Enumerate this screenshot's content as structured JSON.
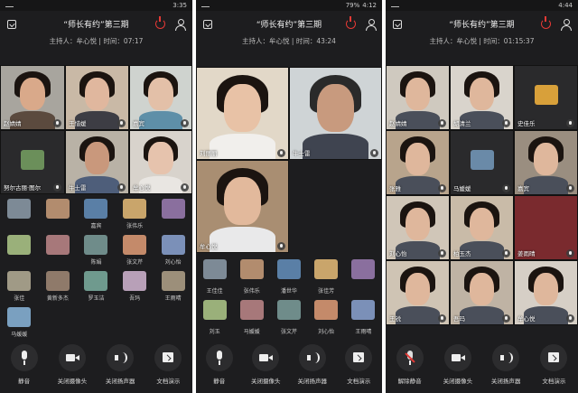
{
  "panels": [
    {
      "status": {
        "time": "3:35",
        "battery": ""
      },
      "title": "“师长有约”第三期",
      "host_label": "主持人：牟心悦",
      "time_label": "时间：07:17",
      "tiles": [
        "赵婧婧",
        "王惜媛",
        "嘉宾",
        "努尔古丽·图尔",
        "牛士雷",
        "牟心悦"
      ],
      "thumbs": [
        "",
        "",
        "嘉宾",
        "张伟乐",
        "",
        "",
        "",
        "陈娟",
        "张文芹",
        "刘心怡",
        "张佳",
        "黄新多杰",
        "罗玉洁",
        "吾玛",
        "王雨晴",
        "马媛媛"
      ],
      "toolbar": [
        "静音",
        "关闭摄像头",
        "关闭扬声器",
        "文档演示"
      ]
    },
    {
      "status": {
        "time": "4:12",
        "battery": "79%"
      },
      "title": "“师长有约”第三期",
      "host_label": "主持人：牟心悦",
      "time_label": "时间：43:24",
      "tiles": [
        "刘丽丽",
        "牛士雷",
        "牟心悦"
      ],
      "thumbs": [
        "王佳佳",
        "张伟乐",
        "潘世华",
        "张佳芳",
        "",
        "刘玉",
        "马媛媛",
        "张文芹",
        "刘心怡",
        "王雨晴"
      ],
      "toolbar": [
        "静音",
        "关闭摄像头",
        "关闭扬声器",
        "文档演示"
      ]
    },
    {
      "status": {
        "time": "4:44",
        "battery": ""
      },
      "title": "“师长有约”第三期",
      "host_label": "主持人：牟心悦",
      "time_label": "时间：01:15:37",
      "tiles": [
        "赵婧婧",
        "胡清兰",
        "史佳乐",
        "张雅",
        "马媛媛",
        "嘉宾",
        "刘心怡",
        "柏玉杰",
        "姜雨晴",
        "王锐",
        "吾玛",
        "牟心悦"
      ],
      "toolbar": [
        "解除静音",
        "关闭摄像头",
        "关闭扬声器",
        "文档演示"
      ]
    }
  ],
  "colors": {
    "bg": "#1d1d1f",
    "accent_red": "#e53935"
  }
}
